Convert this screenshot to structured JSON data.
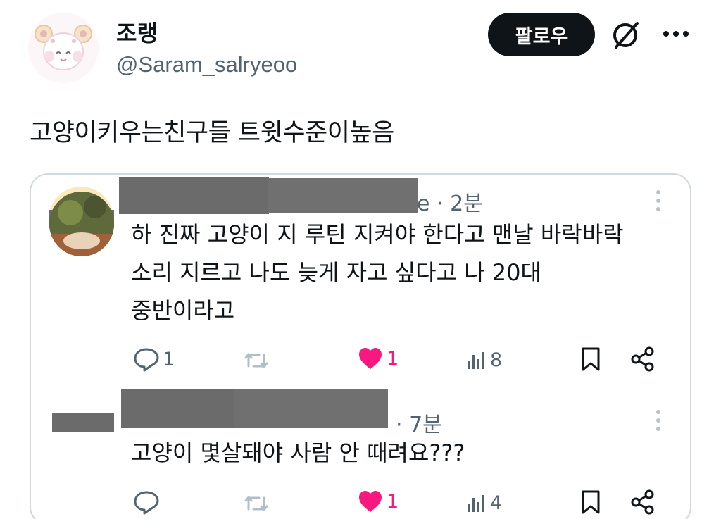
{
  "author": {
    "name": "조랭",
    "handle": "@Saram_salryeoo"
  },
  "header": {
    "follow_label": "팔로우",
    "grok_icon": "grok-slash-circle-icon",
    "more_icon": "more-horizontal-icon"
  },
  "tweet": {
    "text": "고양이키우는친구들 트윗수준이높음"
  },
  "quoted_replies": [
    {
      "meta": "e · 2분",
      "lines": [
        "하 진짜 고양이 지 루틴 지켜야 한다고 맨날 바락바락",
        "소리 지르고 나도 늦게 자고 싶다고 나 20대",
        "중반이라고"
      ],
      "reply_count": "1",
      "retweet_count": "",
      "like_count": "1",
      "view_count": "8",
      "liked": true
    },
    {
      "meta": "· 7분",
      "lines": [
        "고양이 몇살돼야 사람 안 때려요???"
      ],
      "reply_count": "",
      "retweet_count": "",
      "like_count": "1",
      "view_count": "4",
      "liked": true
    }
  ],
  "colors": {
    "text_primary": "#0f1419",
    "text_secondary": "#536471",
    "like_pink": "#f91880",
    "border": "#cfd9de",
    "follow_bg": "#0f1419"
  }
}
